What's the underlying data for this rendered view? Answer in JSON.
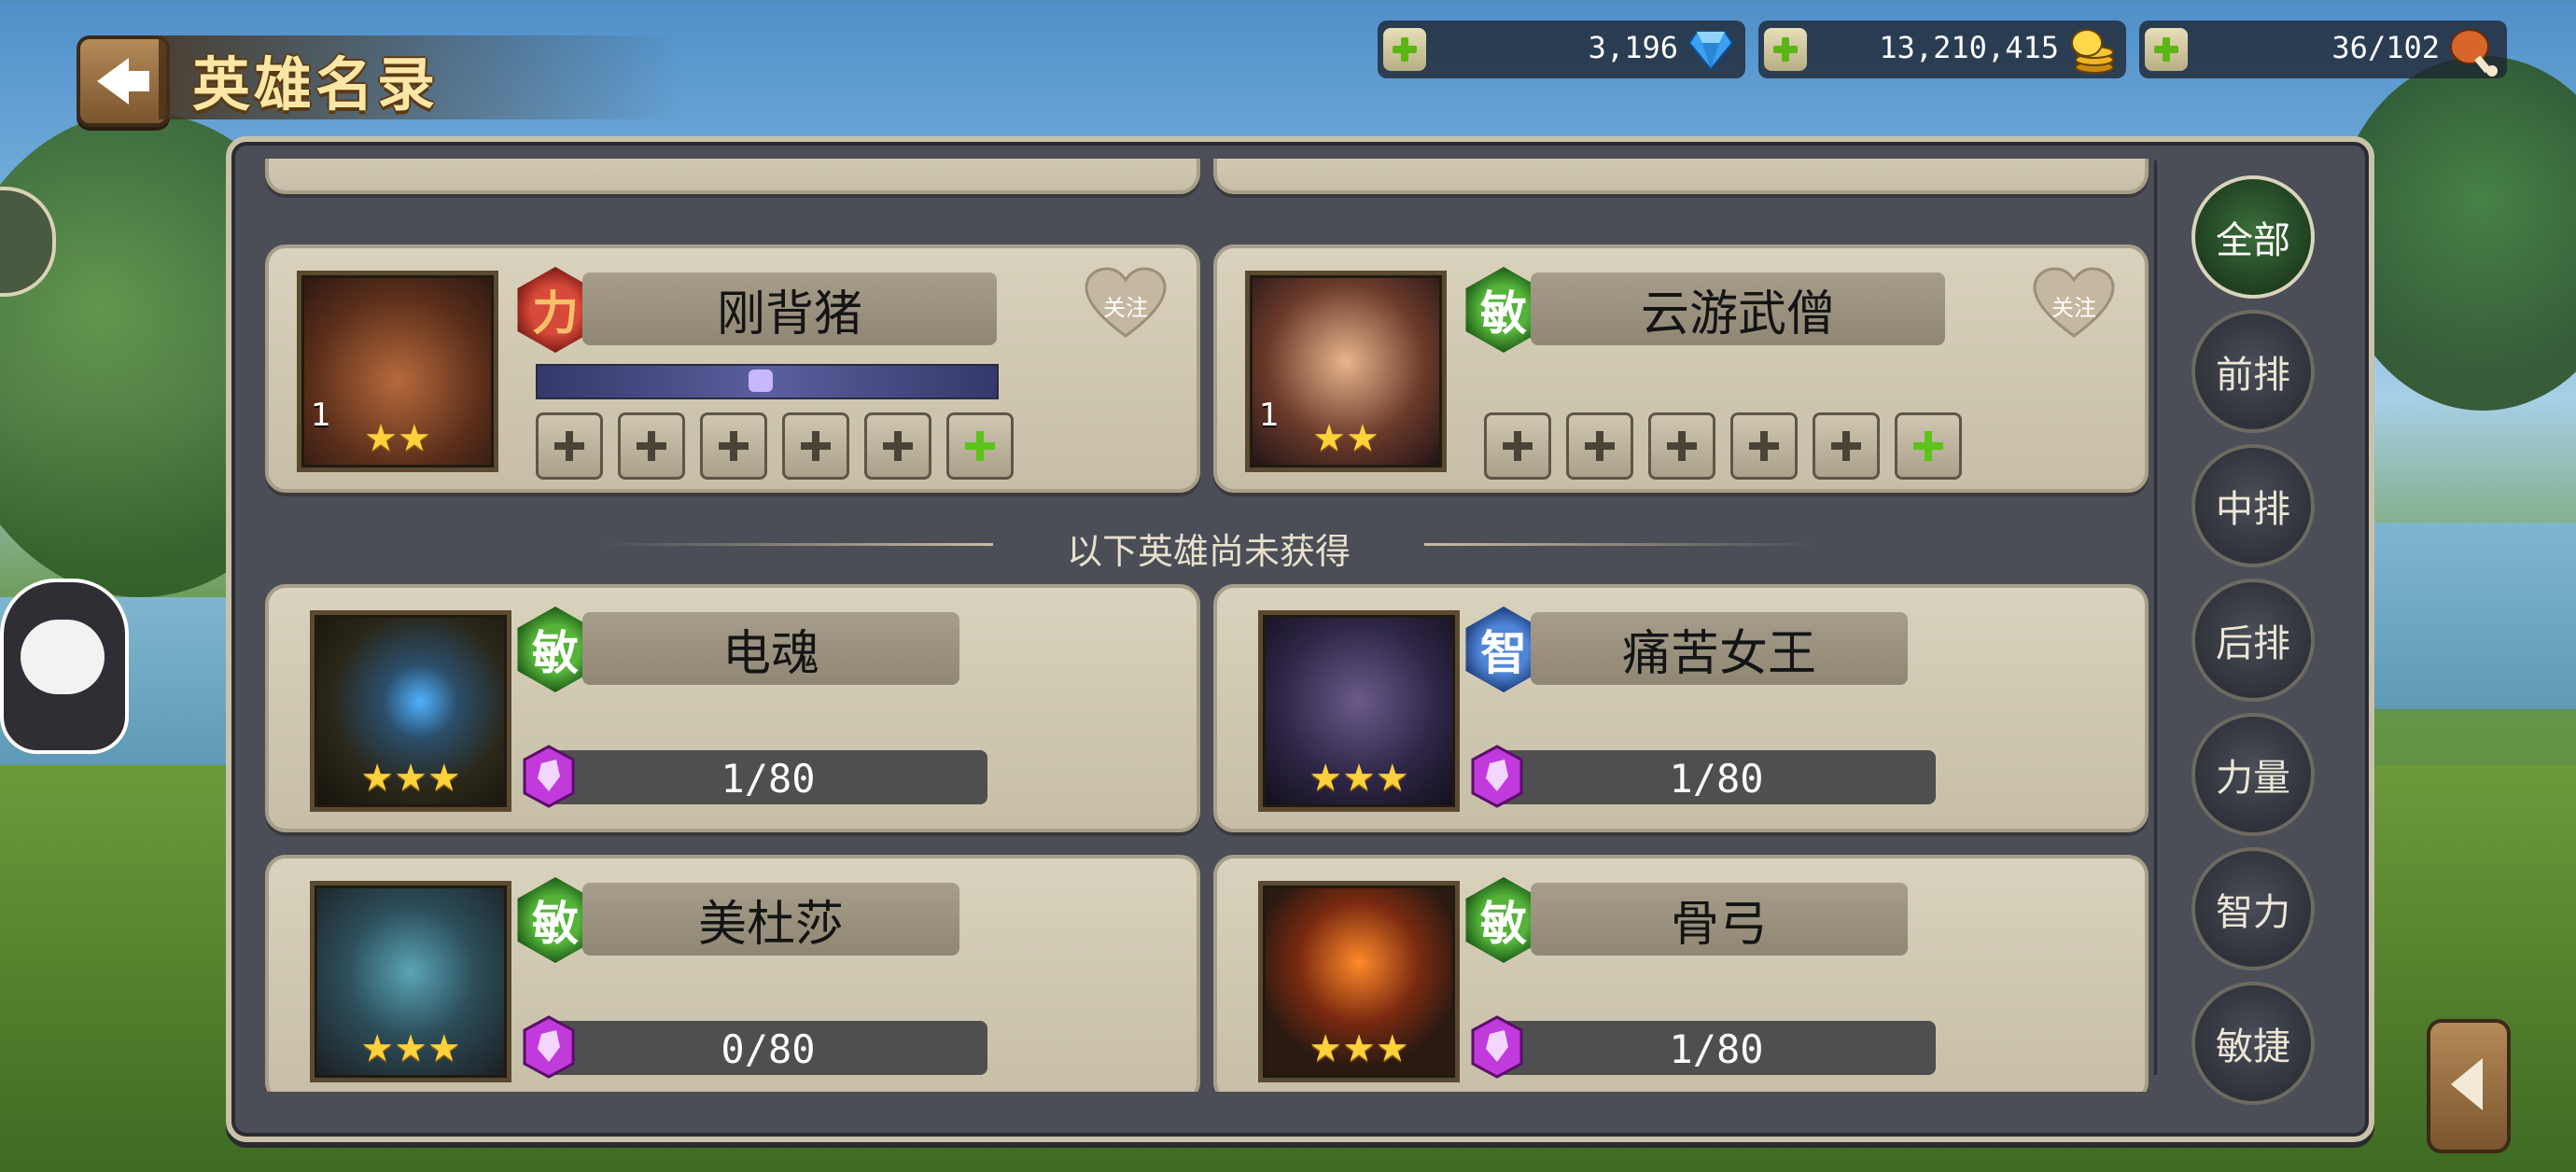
{
  "header": {
    "title": "英雄名录"
  },
  "resources": [
    {
      "name": "diamond",
      "value": "3,196",
      "icon": "diamond-icon"
    },
    {
      "name": "gold",
      "value": "13,210,415",
      "icon": "gold-coin-icon"
    },
    {
      "name": "stamina",
      "value": "36/102",
      "icon": "meat-drumstick-icon"
    }
  ],
  "owned_heroes": [
    {
      "name": "刚背猪",
      "attribute": "力",
      "level": "1",
      "stars": "★★",
      "follow_label": "关注",
      "slots": 6
    },
    {
      "name": "云游武僧",
      "attribute": "敏",
      "level": "1",
      "stars": "★★",
      "follow_label": "关注",
      "slots": 6
    }
  ],
  "divider_text": "以下英雄尚未获得",
  "unowned_heroes": [
    {
      "name": "电魂",
      "attribute": "敏",
      "stars": "★★★",
      "shards": "1/80"
    },
    {
      "name": "痛苦女王",
      "attribute": "智",
      "stars": "★★★",
      "shards": "1/80"
    },
    {
      "name": "美杜莎",
      "attribute": "敏",
      "stars": "★★★",
      "shards": "0/80"
    },
    {
      "name": "骨弓",
      "attribute": "敏",
      "stars": "★★★",
      "shards": "1/80"
    }
  ],
  "filters": [
    "全部",
    "前排",
    "中排",
    "后排",
    "力量",
    "智力",
    "敏捷"
  ],
  "active_filter": "全部",
  "colors": {
    "strength": "#d74a3a",
    "agility": "#55b33a",
    "intelligence": "#4f86d8",
    "panel": "#4b4e57",
    "card": "#d9d2bc"
  }
}
